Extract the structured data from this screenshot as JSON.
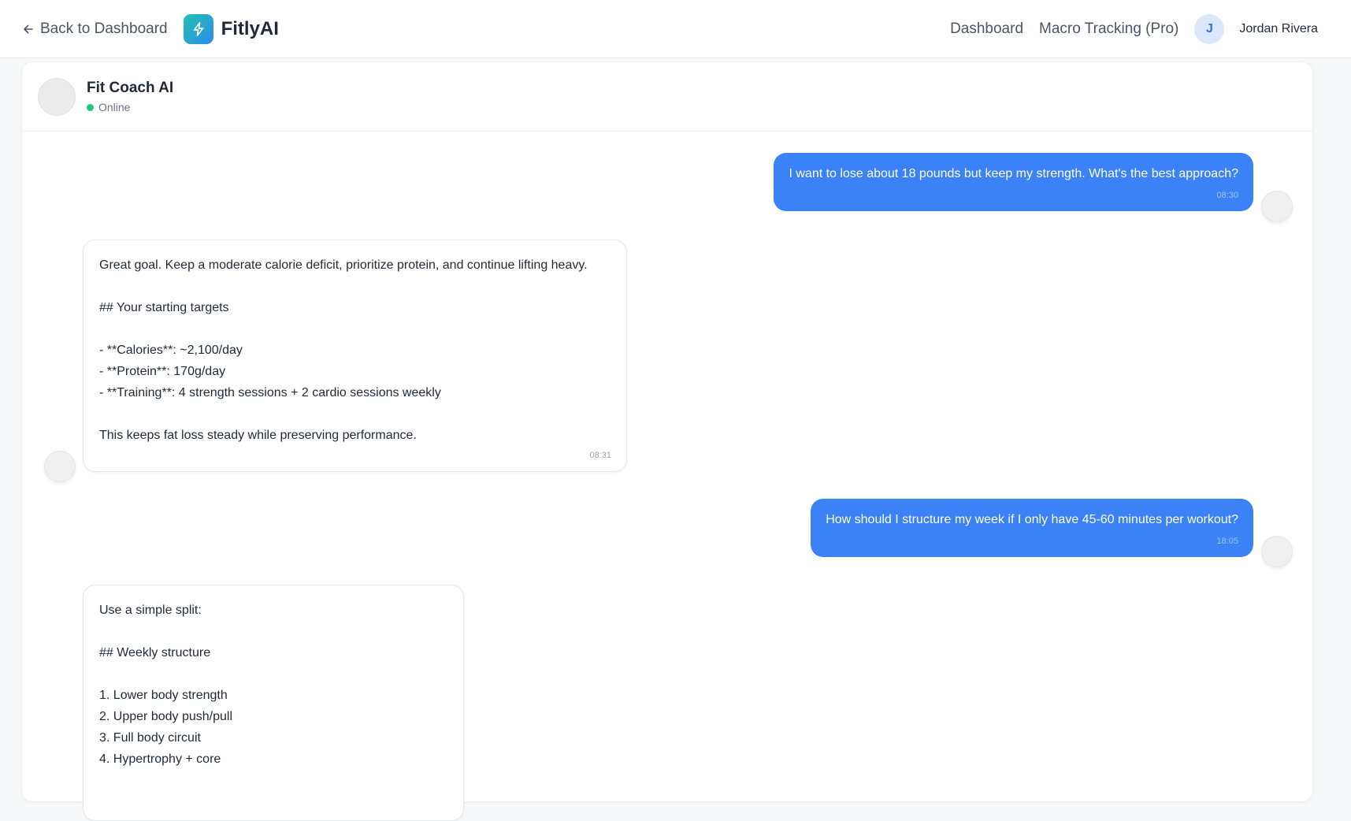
{
  "topbar": {
    "back_label": "Back to Dashboard",
    "brand_name": "FitlyAI",
    "nav": [
      {
        "label": "Dashboard"
      },
      {
        "label": "Macro Tracking (Pro)"
      }
    ],
    "user_initial": "J",
    "user_name": "Jordan Rivera"
  },
  "chat": {
    "coach_name": "Fit Coach AI",
    "status": "Online",
    "messages": [
      {
        "role": "user",
        "text": "I want to lose about 18 pounds but keep my strength. What's the best approach?",
        "time": "08:30"
      },
      {
        "role": "ai",
        "lines": [
          "Great goal. Keep a moderate calorie deficit, prioritize protein, and continue lifting heavy.",
          "",
          "## Your starting targets",
          "",
          "- **Calories**: ~2,100/day",
          "- **Protein**: 170g/day",
          "- **Training**: 4 strength sessions + 2 cardio sessions weekly",
          "",
          "This keeps fat loss steady while preserving performance."
        ],
        "time": "08:31"
      },
      {
        "role": "user",
        "text": "How should I structure my week if I only have 45-60 minutes per workout?",
        "time": "18:05"
      },
      {
        "role": "ai",
        "lines": [
          "Use a simple split:",
          "",
          "## Weekly structure",
          "",
          "1. Lower body strength",
          "2. Upper body push/pull",
          "3. Full body circuit",
          "4. Hypertrophy + core"
        ],
        "time": ""
      }
    ]
  },
  "colors": {
    "accent": "#3b82f6",
    "online": "#22c57e",
    "brand_gradient_start": "#22c1b3",
    "brand_gradient_end": "#2d8ce8"
  }
}
